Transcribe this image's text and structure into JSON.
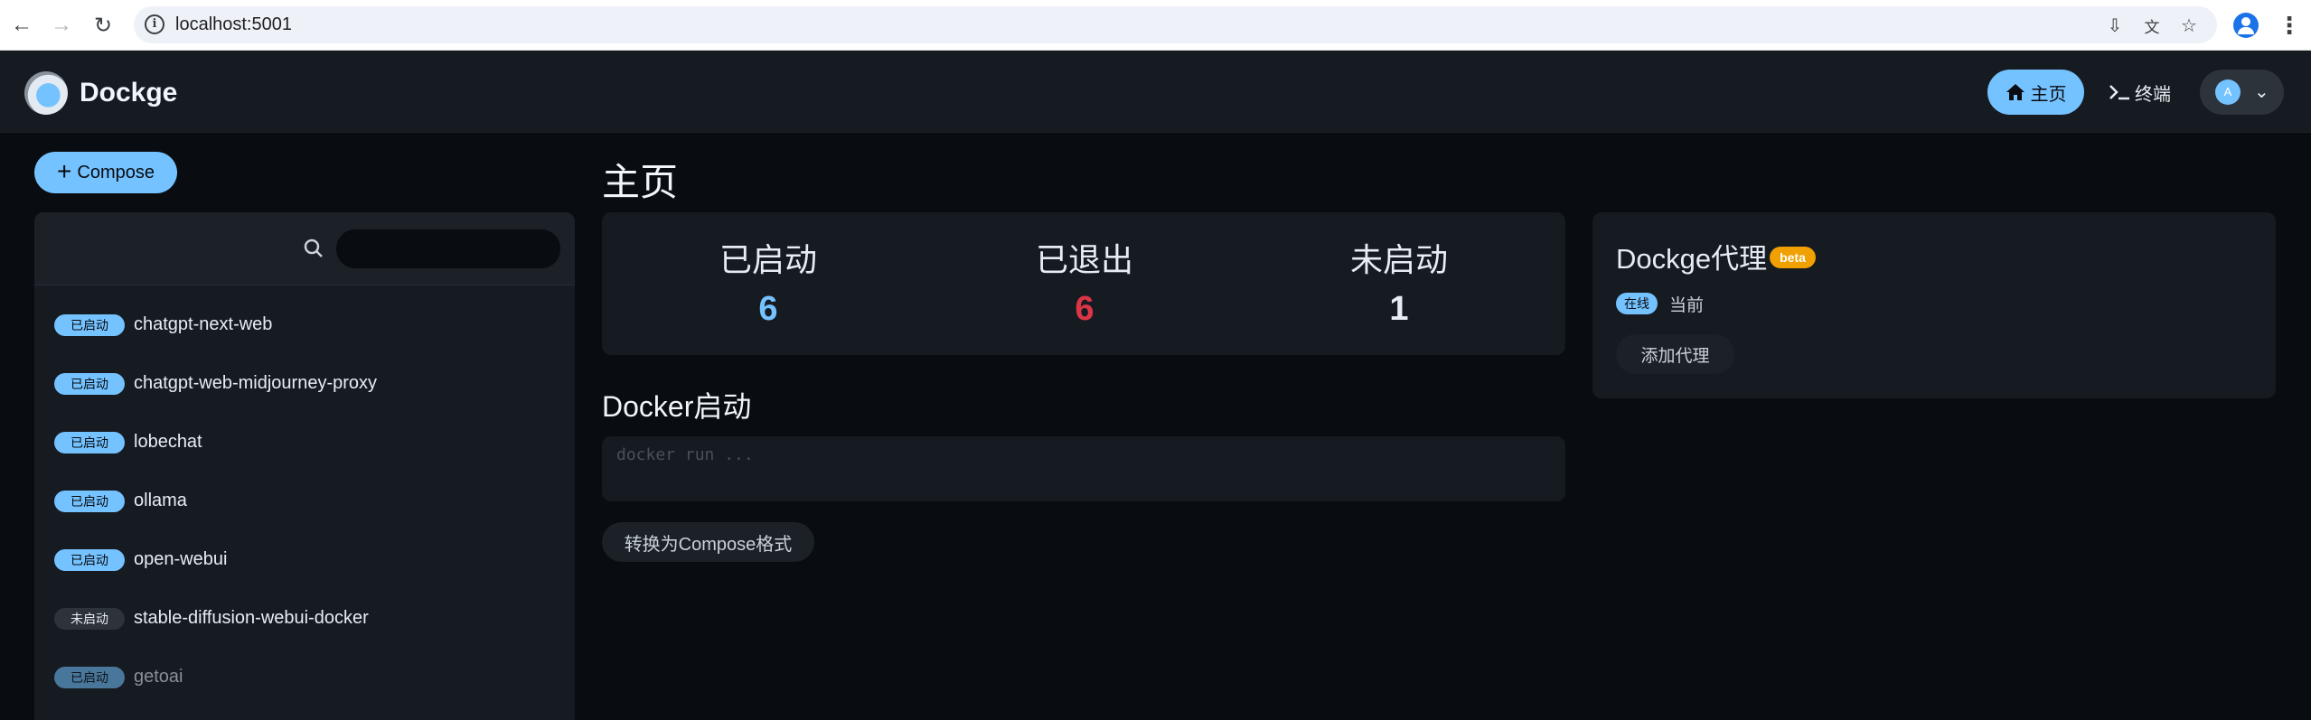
{
  "browser": {
    "url": "localhost:5001",
    "back_icon": "arrow-left-icon",
    "forward_icon": "arrow-right-icon",
    "reload_icon": "reload-icon"
  },
  "header": {
    "brand": "Dockge",
    "nav_home": "主页",
    "nav_terminal": "终端",
    "user_initial": "A"
  },
  "sidebar": {
    "compose_label": "Compose",
    "search_placeholder": "",
    "stacks": [
      {
        "status": "已启动",
        "name": "chatgpt-next-web"
      },
      {
        "status": "已启动",
        "name": "chatgpt-web-midjourney-proxy"
      },
      {
        "status": "已启动",
        "name": "lobechat"
      },
      {
        "status": "已启动",
        "name": "ollama"
      },
      {
        "status": "已启动",
        "name": "open-webui"
      },
      {
        "status": "未启动",
        "name": "stable-diffusion-webui-docker"
      },
      {
        "status": "已启动",
        "name": "getoai"
      }
    ]
  },
  "main": {
    "title": "主页",
    "stats": [
      {
        "label": "已启动",
        "value": "6",
        "color": "#74c2ff"
      },
      {
        "label": "已退出",
        "value": "6",
        "color": "#dc3545"
      },
      {
        "label": "未启动",
        "value": "1",
        "color": "#e8edf3"
      }
    ],
    "docker_title": "Docker启动",
    "docker_placeholder": "docker run ...",
    "convert_label": "转换为Compose格式"
  },
  "agent": {
    "title": "Dockge代理",
    "beta": "beta",
    "online": "在线",
    "current": "当前",
    "add_label": "添加代理"
  },
  "colors": {
    "accent": "#74c2ff",
    "exited": "#dc3545",
    "warning": "#f0a000",
    "background": "#090c10",
    "panel": "#161b22"
  }
}
